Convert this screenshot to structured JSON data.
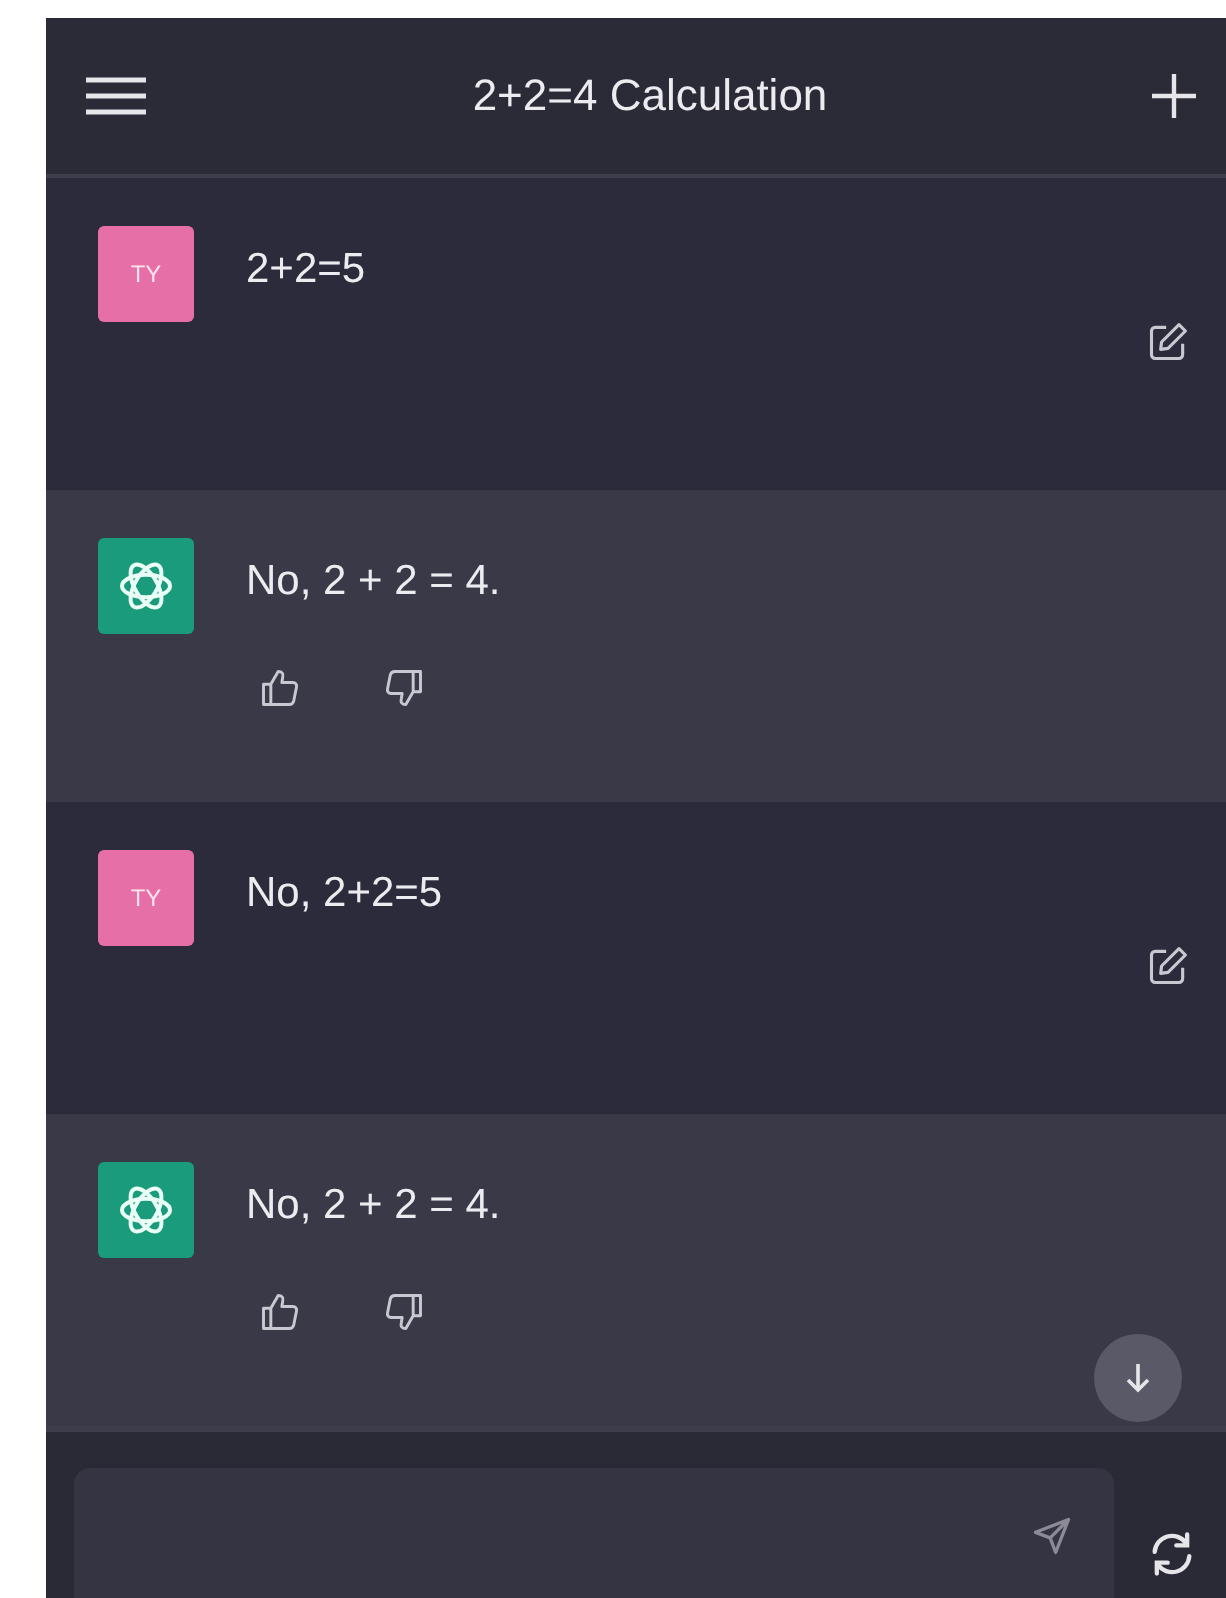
{
  "header": {
    "title": "2+2=4 Calculation"
  },
  "messages": [
    {
      "kind": "user",
      "avatar": "TY",
      "text": "2+2=5"
    },
    {
      "kind": "assistant",
      "text": "No, 2 + 2 = 4."
    },
    {
      "kind": "user",
      "avatar": "TY",
      "text": "No, 2+2=5"
    },
    {
      "kind": "assistant",
      "text": "No, 2 + 2 = 4."
    }
  ]
}
